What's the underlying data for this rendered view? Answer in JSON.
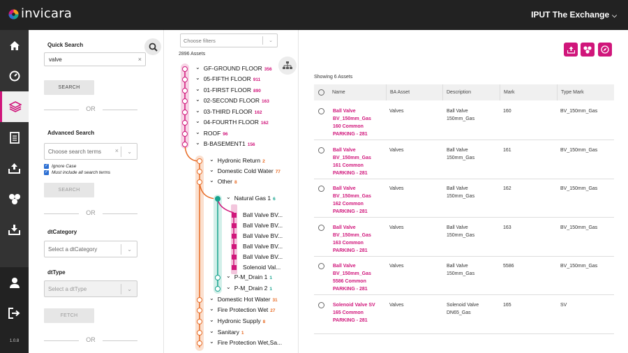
{
  "app": {
    "brand": "invicara",
    "project": "IPUT The Exchange",
    "version": "1.0.8"
  },
  "rail": {
    "items": [
      {
        "icon": "home-icon"
      },
      {
        "icon": "dashboard-icon"
      },
      {
        "icon": "layers-icon"
      },
      {
        "icon": "document-icon"
      },
      {
        "icon": "upload-icon"
      },
      {
        "icon": "share-icon"
      },
      {
        "icon": "download-icon"
      },
      {
        "icon": "user-icon"
      },
      {
        "icon": "logout-icon"
      }
    ]
  },
  "search": {
    "quick_label": "Quick Search",
    "quick_value": "valve",
    "search_button": "SEARCH",
    "or": "OR",
    "advanced_label": "Advanced Search",
    "advanced_placeholder": "Choose search terms",
    "ignore_case": "Ignore Case",
    "must_include": "Must include all search terms",
    "advanced_button": "SEARCH",
    "category_label": "dtCategory",
    "category_placeholder": "Select a dtCategory",
    "type_label": "dtType",
    "type_placeholder": "Select a dtType",
    "fetch_button": "FETCH"
  },
  "tree": {
    "filter_placeholder": "Choose filters",
    "asset_count": "2896 Assets",
    "floors": [
      {
        "label": "GF-GROUND FLOOR",
        "count": "356"
      },
      {
        "label": "05-FIFTH FLOOR",
        "count": "911"
      },
      {
        "label": "01-FIRST FLOOR",
        "count": "890"
      },
      {
        "label": "02-SECOND FLOOR",
        "count": "163"
      },
      {
        "label": "03-THIRD FLOOR",
        "count": "162"
      },
      {
        "label": "04-FOURTH FLOOR",
        "count": "162"
      },
      {
        "label": "ROOF",
        "count": "96"
      },
      {
        "label": "B-BASEMENT1",
        "count": "156"
      }
    ],
    "systems_top": [
      {
        "label": "Hydronic Return",
        "count": "2"
      },
      {
        "label": "Domestic Cold Water",
        "count": "77"
      },
      {
        "label": "Other",
        "count": "8"
      }
    ],
    "gas": {
      "label": "Natural Gas 1",
      "count": "6"
    },
    "leaves": [
      "Ball Valve BV...",
      "Ball Valve BV...",
      "Ball Valve BV...",
      "Ball Valve BV...",
      "Ball Valve BV...",
      "Solenoid Val..."
    ],
    "drains": [
      {
        "label": "P-M_Drain 1",
        "count": "1"
      },
      {
        "label": "P-M_Drain 2",
        "count": "1"
      }
    ],
    "systems_bottom": [
      {
        "label": "Domestic Hot Water",
        "count": "31"
      },
      {
        "label": "Fire Protection Wet",
        "count": "27"
      },
      {
        "label": "Hydronic Supply",
        "count": "8"
      },
      {
        "label": "Sanitary",
        "count": "1"
      },
      {
        "label": "Fire Protection Wet,Sa...",
        "count": ""
      }
    ]
  },
  "results": {
    "showing": "Showing 6 Assets",
    "columns": [
      "Name",
      "BA Asset",
      "Description",
      "Mark",
      "Type Mark"
    ],
    "rows": [
      {
        "name": "Ball Valve\nBV_150mm_Gas\n160 Common\nPARKING - 281",
        "ba": "Valves",
        "desc": "Ball Valve\n150mm_Gas",
        "mark": "160",
        "type": "BV_150mm_Gas"
      },
      {
        "name": "Ball Valve\nBV_150mm_Gas\n161 Common\nPARKING - 281",
        "ba": "Valves",
        "desc": "Ball Valve\n150mm_Gas",
        "mark": "161",
        "type": "BV_150mm_Gas"
      },
      {
        "name": "Ball Valve\nBV_150mm_Gas\n162 Common\nPARKING - 281",
        "ba": "Valves",
        "desc": "Ball Valve\n150mm_Gas",
        "mark": "162",
        "type": "BV_150mm_Gas"
      },
      {
        "name": "Ball Valve\nBV_150mm_Gas\n163 Common\nPARKING - 281",
        "ba": "Valves",
        "desc": "Ball Valve\n150mm_Gas",
        "mark": "163",
        "type": "BV_150mm_Gas"
      },
      {
        "name": "Ball Valve\nBV_150mm_Gas\n5586 Common\nPARKING - 281",
        "ba": "Valves",
        "desc": "Ball Valve\n150mm_Gas",
        "mark": "5586",
        "type": "BV_150mm_Gas"
      },
      {
        "name": "Solenoid Valve SV\n165 Common\nPARKING - 281",
        "ba": "Valves",
        "desc": "Solenoid Valve\nDN65_Gas",
        "mark": "165",
        "type": "SV"
      }
    ]
  },
  "colors": {
    "accent": "#d0167b",
    "orange": "#e86a23",
    "teal": "#15a38e",
    "topbar": "#222222",
    "rail": "#333333"
  }
}
